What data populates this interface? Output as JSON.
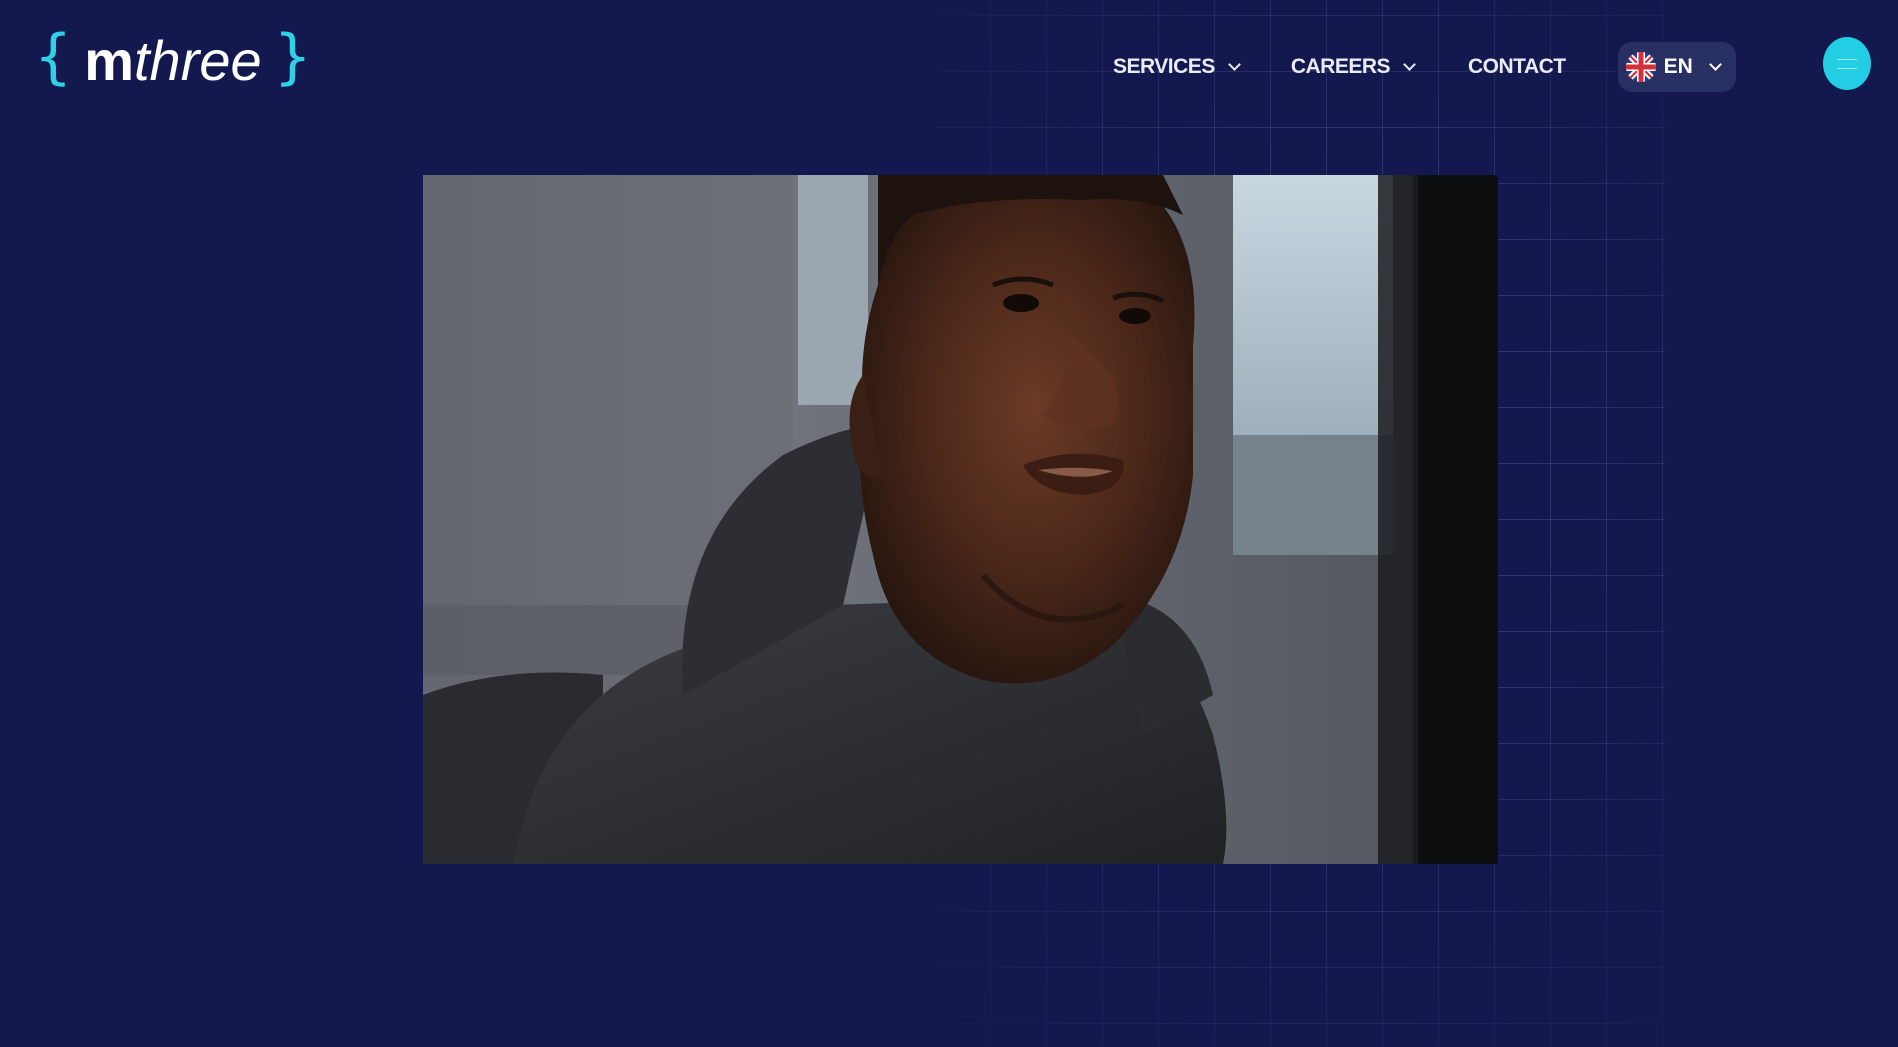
{
  "brand": {
    "logo_open": "{",
    "logo_m": "m",
    "logo_three": "three",
    "logo_close": "}",
    "accent_color": "#2fd1e6",
    "background_color": "#13194f"
  },
  "nav": {
    "services_label": "SERVICES",
    "careers_label": "CAREERS",
    "contact_label": "CONTACT",
    "language_label": "EN",
    "language_flag_icon": "uk-flag-icon",
    "dropdown_icon": "chevron-down-icon"
  },
  "menu_button": {
    "icon": "menu-icon",
    "color": "#23cde3"
  },
  "media": {
    "type": "video-still",
    "subject": "man-in-hoodie-looking-at-screen"
  }
}
